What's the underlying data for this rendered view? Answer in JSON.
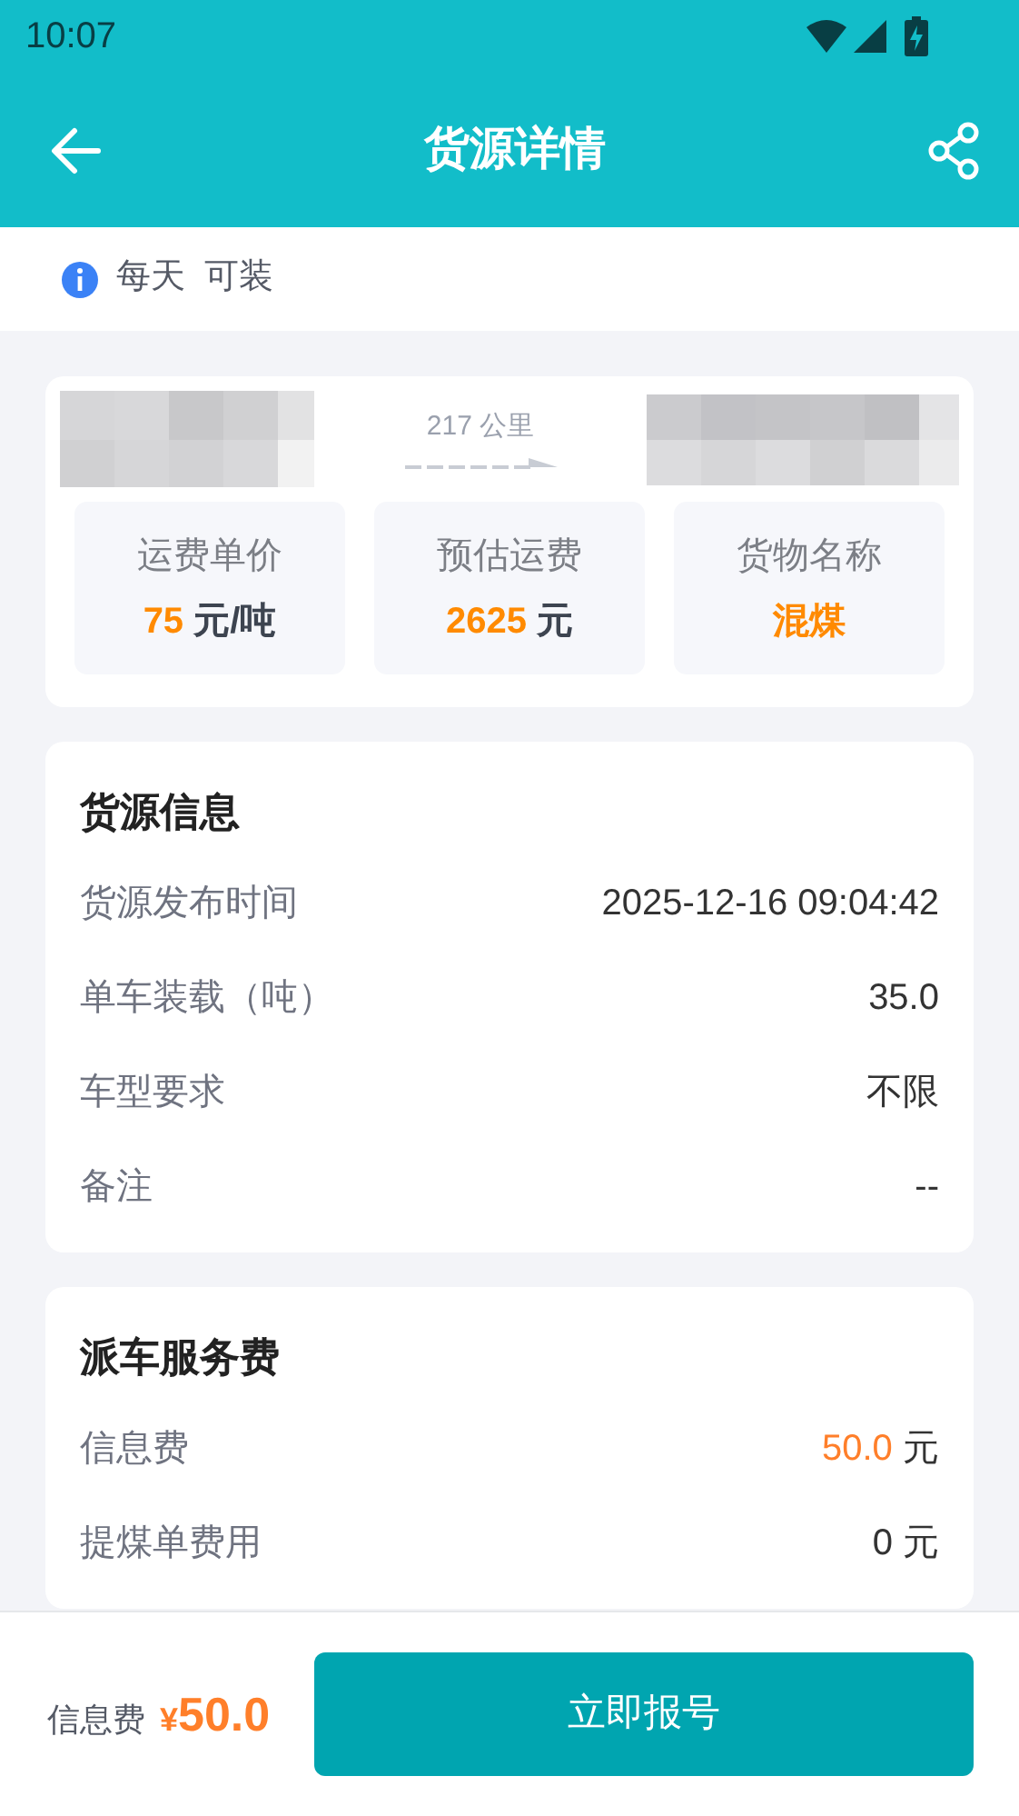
{
  "status_bar": {
    "time": "10:07"
  },
  "toolbar": {
    "title": "货源详情"
  },
  "notice": {
    "text": "每天  可装"
  },
  "route": {
    "distance": "217 公里"
  },
  "stats": [
    {
      "label": "运费单价",
      "value": "75",
      "unit": "元/吨"
    },
    {
      "label": "预估运费",
      "value": "2625",
      "unit": "元"
    },
    {
      "label": "货物名称",
      "value": "混煤"
    }
  ],
  "sections": [
    {
      "title": "货源信息",
      "rows": [
        {
          "label": "货源发布时间",
          "value": "2025-12-16 09:04:42",
          "highlight": false
        },
        {
          "label": "单车装载（吨）",
          "value": "35.0",
          "highlight": false
        },
        {
          "label": "车型要求",
          "value": "不限",
          "highlight": false
        },
        {
          "label": "备注",
          "value": "--",
          "highlight": false
        }
      ]
    },
    {
      "title": "派车服务费",
      "rows": [
        {
          "label": "信息费",
          "value": "50.0",
          "unit": "元",
          "highlight": true
        },
        {
          "label": "提煤单费用",
          "value": "0",
          "unit": "元",
          "highlight": false
        }
      ]
    }
  ],
  "footer": {
    "fee_label": "信息费",
    "currency": "¥",
    "fee": "50.0",
    "button": "立即报号"
  }
}
